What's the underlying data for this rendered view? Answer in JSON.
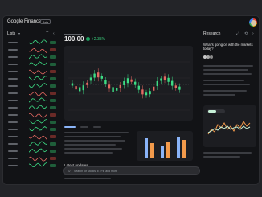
{
  "app": {
    "title": "Google Finance",
    "badge": "Beta"
  },
  "left": {
    "title": "Lists",
    "caret": "▾",
    "add_icon": "+",
    "collapse_icon": "‹"
  },
  "main": {
    "price": "100.00",
    "change": "+2.35%",
    "latest_label": "Latest updates"
  },
  "search": {
    "placeholder": "Search for stocks, ETFs, and more"
  },
  "research": {
    "title": "Research",
    "question": "What's going on with the markets today?"
  },
  "colors": {
    "up": "#3ddc84",
    "down": "#e46962",
    "bar_orange": "#f29a4b",
    "bar_blue": "#8ab4f8",
    "accent_green": "#c6f0d6"
  },
  "icons": {
    "search": "search-icon",
    "share": "share-icon",
    "history": "history-icon",
    "collapse": "collapse-icon"
  }
}
